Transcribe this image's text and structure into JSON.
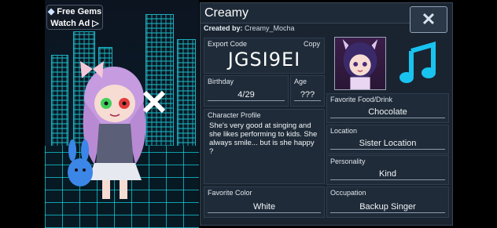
{
  "top_left": {
    "free_gems": "Free Gems",
    "watch_ad": "Watch Ad ▷",
    "gem_icon": "diamond-icon"
  },
  "panel": {
    "name": "Creamy",
    "created_by_label": "Created by:",
    "created_by_value": "Creamy_Mocha",
    "close_symbol": "✕"
  },
  "export": {
    "label": "Export Code",
    "copy": "Copy",
    "code": "JGSI9EI"
  },
  "birthday": {
    "label": "Birthday",
    "value": "4/29"
  },
  "age": {
    "label": "Age",
    "value": "???"
  },
  "profile": {
    "label": "Character Profile",
    "text": "She's very good at singing and she likes performing to kids. She always smile... but is she happy ?"
  },
  "favorite_color": {
    "label": "Favorite Color",
    "value": "White"
  },
  "favorite_food": {
    "label": "Favorite Food/Drink",
    "value": "Chocolate"
  },
  "location": {
    "label": "Location",
    "value": "Sister Location"
  },
  "personality": {
    "label": "Personality",
    "value": "Kind"
  },
  "occupation": {
    "label": "Occupation",
    "value": "Backup Singer"
  },
  "colors": {
    "neon": "#1fd6e6",
    "panel": "#1a2430",
    "accent_music": "#19c3f0"
  }
}
